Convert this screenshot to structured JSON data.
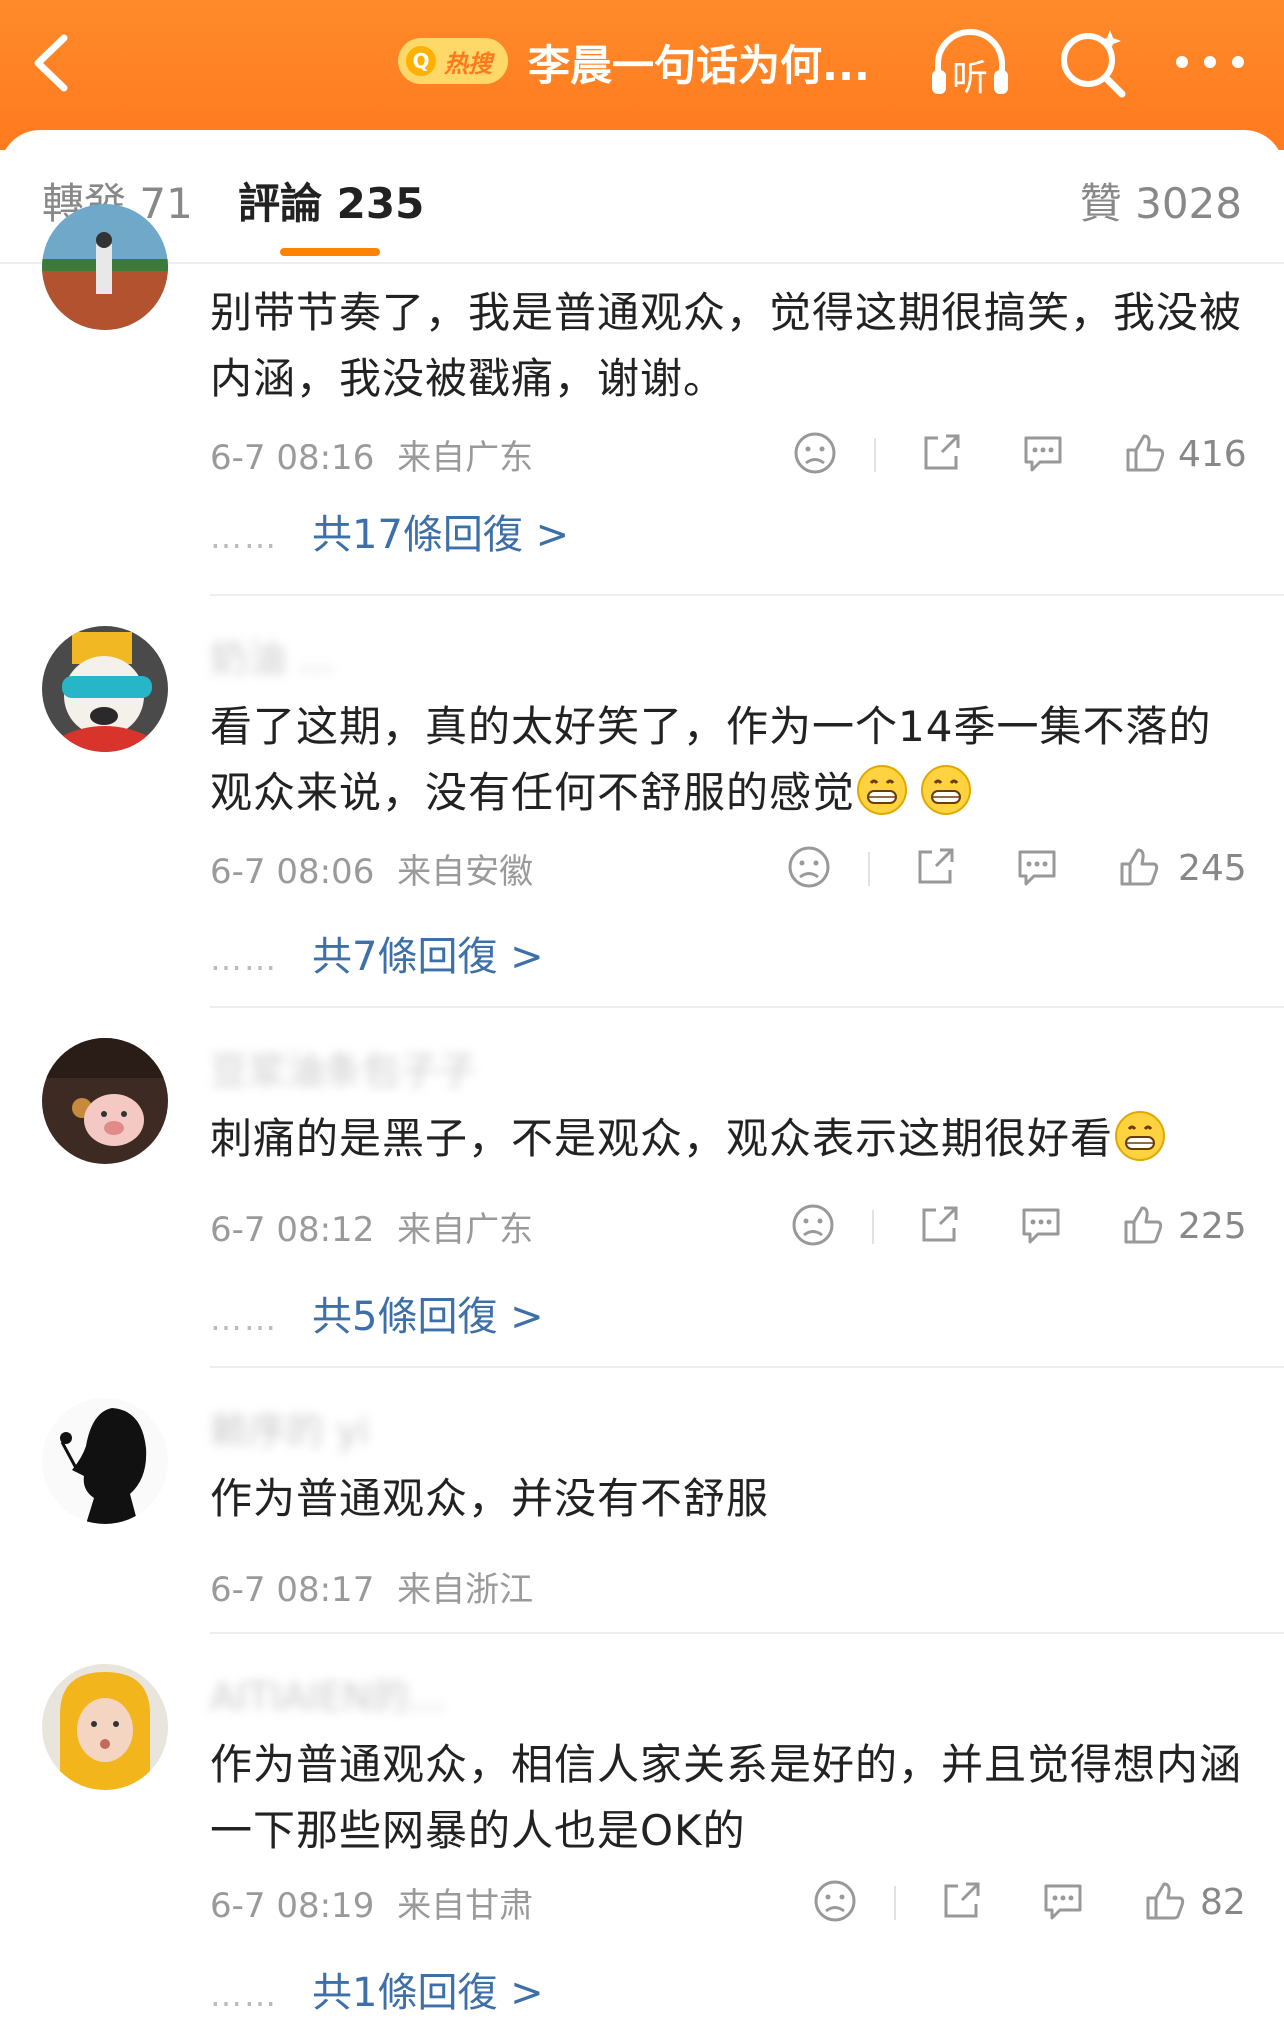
{
  "topbar": {
    "hot_badge": "热搜",
    "title": "李晨一句话为何...",
    "listen_label": "听"
  },
  "tabs": {
    "forward": "轉發 71",
    "comment": "評論 235",
    "like": "贊 3028"
  },
  "comments": [
    {
      "username": "",
      "text": "别带节奏了，我是普通观众，觉得这期很搞笑，我没被内涵，我没被戳痛，谢谢。",
      "time": "6-7 08:16",
      "location": "来自广东",
      "likes": "416",
      "replies": "共17條回復 >"
    },
    {
      "username": "奶油 ...",
      "text": "看了这期，真的太好笑了，作为一个14季一集不落的观众来说，没有任何不舒服的感觉",
      "time": "6-7 08:06",
      "location": "来自安徽",
      "likes": "245",
      "replies": "共7條回復 >"
    },
    {
      "username": "豆浆油条包子子",
      "text": "刺痛的是黑子，不是观众，观众表示这期很好看",
      "time": "6-7 08:12",
      "location": "来自广东",
      "likes": "225",
      "replies": "共5條回復 >"
    },
    {
      "username": "赖序的 yi",
      "text": "作为普通观众，并没有不舒服",
      "time": "6-7 08:17",
      "location": "来自浙江",
      "likes": "",
      "replies": ""
    },
    {
      "username": "AITIAIEN的...",
      "text": "作为普通观众，相信人家关系是好的，并且觉得想内涵一下那些网暴的人也是OK的",
      "time": "6-7 08:19",
      "location": "来自甘肃",
      "likes": "82",
      "replies": "共1條回復 >"
    }
  ],
  "ui": {
    "dots": "……"
  },
  "colors": {
    "accent": "#ff8200",
    "link": "#3d6fa8",
    "topbar": "#ff7a1e"
  }
}
